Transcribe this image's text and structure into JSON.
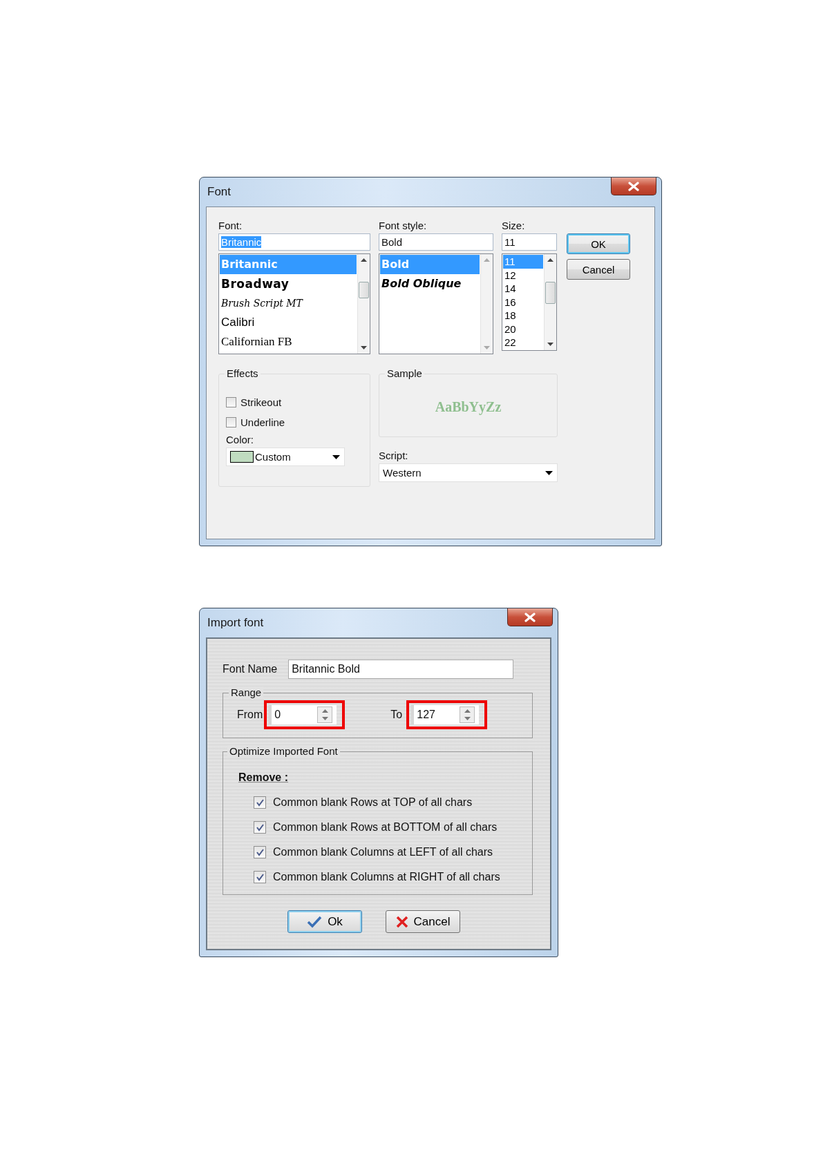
{
  "font_dialog": {
    "title": "Font",
    "font": {
      "label": "Font:",
      "value": "Britannic",
      "text_selected": true,
      "items": [
        {
          "label": "Britannic",
          "selected": true
        },
        {
          "label": "Broadway",
          "selected": false
        },
        {
          "label": "Brush Script MT",
          "selected": false
        },
        {
          "label": "Calibri",
          "selected": false
        },
        {
          "label": "Californian FB",
          "selected": false
        }
      ]
    },
    "font_style": {
      "label": "Font style:",
      "value": "Bold",
      "items": [
        {
          "label": "Bold",
          "selected": true
        },
        {
          "label": "Bold Oblique",
          "selected": false
        }
      ]
    },
    "size": {
      "label": "Size:",
      "value": "11",
      "items": [
        {
          "label": "11",
          "selected": true
        },
        {
          "label": "12",
          "selected": false
        },
        {
          "label": "14",
          "selected": false
        },
        {
          "label": "16",
          "selected": false
        },
        {
          "label": "18",
          "selected": false
        },
        {
          "label": "20",
          "selected": false
        },
        {
          "label": "22",
          "selected": false
        }
      ]
    },
    "buttons": [
      {
        "label": "OK",
        "focused": true
      },
      {
        "label": "Cancel",
        "focused": false
      }
    ],
    "effects": {
      "title": "Effects",
      "checkboxes": [
        {
          "label": "Strikeout",
          "checked": false
        },
        {
          "label": "Underline",
          "checked": false
        }
      ],
      "color_label": "Color:",
      "color_value": "Custom"
    },
    "sample": {
      "title": "Sample",
      "text": "AaBbYyZz"
    },
    "script": {
      "label": "Script:",
      "value": "Western"
    }
  },
  "import_dialog": {
    "title": "Import font",
    "font_name": {
      "label": "Font Name",
      "value": "Britannic Bold"
    },
    "range": {
      "title": "Range",
      "fields": [
        {
          "label": "From",
          "value": "0",
          "highlighted": true
        },
        {
          "label": "To",
          "value": "127",
          "highlighted": true
        }
      ]
    },
    "optimize": {
      "title": "Optimize Imported Font",
      "heading": "Remove :",
      "checkboxes": [
        {
          "label": "Common blank Rows at TOP of all chars",
          "checked": true
        },
        {
          "label": "Common blank Rows at BOTTOM of all chars",
          "checked": true
        },
        {
          "label": "Common blank Columns at LEFT of all chars",
          "checked": true
        },
        {
          "label": "Common blank Columns at RIGHT of all chars",
          "checked": true
        }
      ]
    },
    "buttons": [
      {
        "kind": "ok",
        "label": "Ok",
        "focused": true
      },
      {
        "kind": "cancel",
        "label": "Cancel",
        "focused": false
      }
    ]
  }
}
